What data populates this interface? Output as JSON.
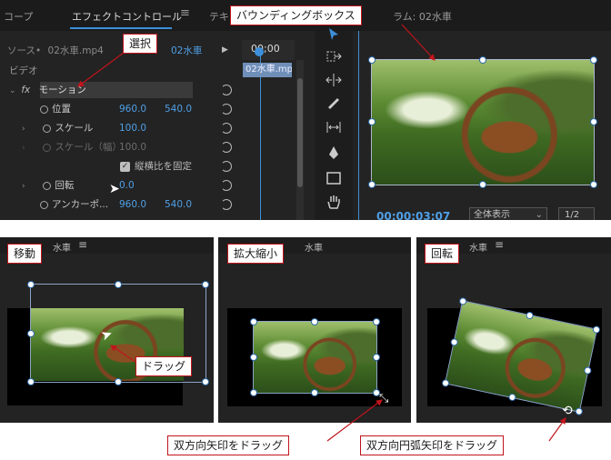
{
  "top": {
    "tabs": [
      "コープ",
      "エフェクトコントロール",
      "テキ",
      "ラム: 02水車"
    ],
    "source_label": "ソース",
    "clip_name": "02水車.mp4",
    "sequence_clip": "02水車",
    "timecode_head": "00;00",
    "timeline_clip": "02水車.mp",
    "video_section": "ビデオ",
    "fx_label": "fx",
    "motion_label": "モーション",
    "properties": [
      {
        "name": "位置",
        "v1": "960.0",
        "v2": "540.0"
      },
      {
        "name": "スケール",
        "v1": "100.0",
        "v2": ""
      },
      {
        "name": "スケール（幅）",
        "v1": "100.0",
        "v2": ""
      },
      {
        "name": "縦横比を固定",
        "v1": "",
        "v2": ""
      },
      {
        "name": "回転",
        "v1": "0.0",
        "v2": ""
      },
      {
        "name": "アンカーポ...",
        "v1": "960.0",
        "v2": "540.0"
      }
    ],
    "program_timecode": "00:00:03:07",
    "zoom_select": "全体表示",
    "resolution": "1/2"
  },
  "callouts": {
    "bounding_box": "バウンディングボックス",
    "select": "選択",
    "move": "移動",
    "drag": "ドラッグ",
    "scale": "拡大縮小",
    "rotate": "回転",
    "drag_double_arrow": "双方向矢印をドラッグ",
    "drag_arc_arrow": "双方向円弧矢印をドラッグ"
  },
  "sub_tabs": {
    "left": "水車",
    "middle": "水車",
    "right": "水車"
  },
  "colors": {
    "accent_blue": "#4f9fe6",
    "callout_border": "#c0141c",
    "panel_bg": "#232323"
  },
  "icons": [
    "hamburger-icon",
    "stopwatch-icon",
    "reset-icon",
    "selection-tool-icon",
    "track-select-icon",
    "ripple-edit-icon",
    "razor-icon",
    "slip-icon",
    "pen-icon",
    "rectangle-icon",
    "hand-icon",
    "mouse-cursor-icon",
    "double-arrow-icon",
    "arc-arrow-icon"
  ]
}
